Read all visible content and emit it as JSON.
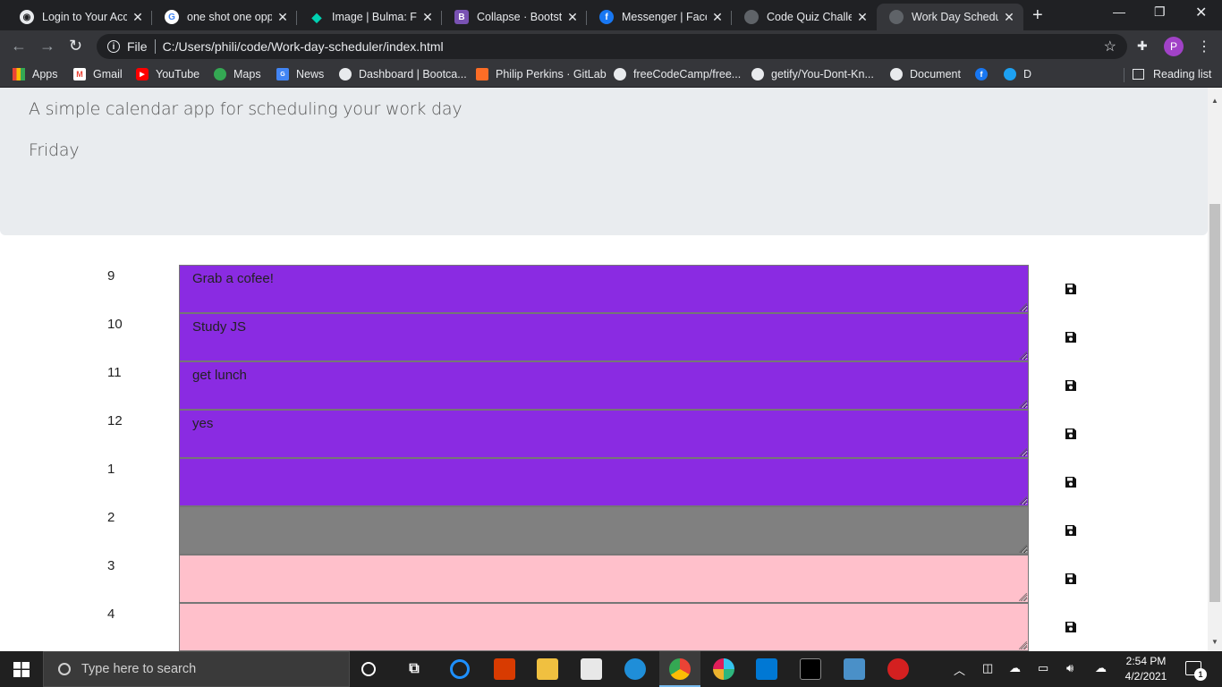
{
  "browser": {
    "tabs": [
      {
        "title": "Login to Your Acco",
        "icon": "chrome-web-icon"
      },
      {
        "title": "one shot one oppo",
        "icon": "google-icon"
      },
      {
        "title": "Image | Bulma: Fre",
        "icon": "bulma-icon"
      },
      {
        "title": "Collapse · Bootstra",
        "icon": "bootstrap-icon"
      },
      {
        "title": "Messenger | Faceb",
        "icon": "facebook-icon"
      },
      {
        "title": "Code Quiz Challen",
        "icon": "globe-icon"
      },
      {
        "title": "Work Day Schedul",
        "icon": "globe-icon",
        "active": true
      }
    ],
    "file_label": "File",
    "url": "C:/Users/phili/code/Work-day-scheduler/index.html",
    "profile_initial": "P",
    "bookmarks": [
      "Apps",
      "Gmail",
      "YouTube",
      "Maps",
      "News",
      "Dashboard | Bootca...",
      "Philip Perkins · GitLab",
      "freeCodeCamp/free...",
      "getify/You-Dont-Kn...",
      "Document",
      "",
      "D"
    ],
    "reading_list": "Reading list"
  },
  "page": {
    "lead": "A simple calendar app for scheduling your work day",
    "current_day": "Friday",
    "rows": [
      {
        "hour": "9",
        "text": "Grab a cofee!",
        "state": "future"
      },
      {
        "hour": "10",
        "text": "Study JS",
        "state": "future"
      },
      {
        "hour": "11",
        "text": "get lunch",
        "state": "future"
      },
      {
        "hour": "12",
        "text": "yes",
        "state": "future"
      },
      {
        "hour": "1",
        "text": "",
        "state": "future"
      },
      {
        "hour": "2",
        "text": "",
        "state": "present"
      },
      {
        "hour": "3",
        "text": "",
        "state": "past"
      },
      {
        "hour": "4",
        "text": "",
        "state": "past"
      }
    ],
    "colors": {
      "future": "#8a2be2",
      "present": "#808080",
      "past": "#ffc0cb"
    }
  },
  "taskbar": {
    "search_placeholder": "Type here to search",
    "time": "2:54 PM",
    "date": "4/2/2021",
    "notification_count": "1"
  }
}
